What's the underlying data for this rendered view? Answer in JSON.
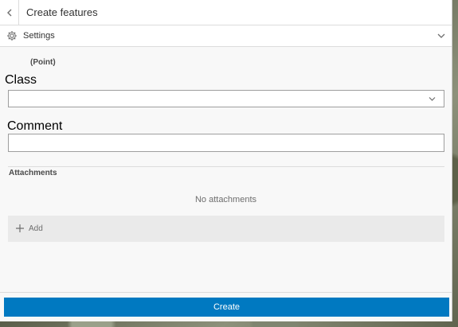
{
  "header": {
    "title": "Create features",
    "back_icon": "chevron-left-icon"
  },
  "settings": {
    "label": "Settings",
    "icon": "gear-icon",
    "toggle_icon": "chevron-down-icon"
  },
  "form": {
    "layer_type": "(Point)",
    "fields": [
      {
        "label": "Class",
        "type": "select",
        "value": ""
      },
      {
        "label": "Comment",
        "type": "text",
        "value": ""
      }
    ]
  },
  "attachments": {
    "title": "Attachments",
    "empty_text": "No attachments",
    "add_label": "Add",
    "add_icon": "plus-icon"
  },
  "footer": {
    "create_label": "Create"
  },
  "colors": {
    "primary": "#0079c1",
    "panel_bg": "#f8f8f8",
    "border": "#9e9e9e"
  }
}
